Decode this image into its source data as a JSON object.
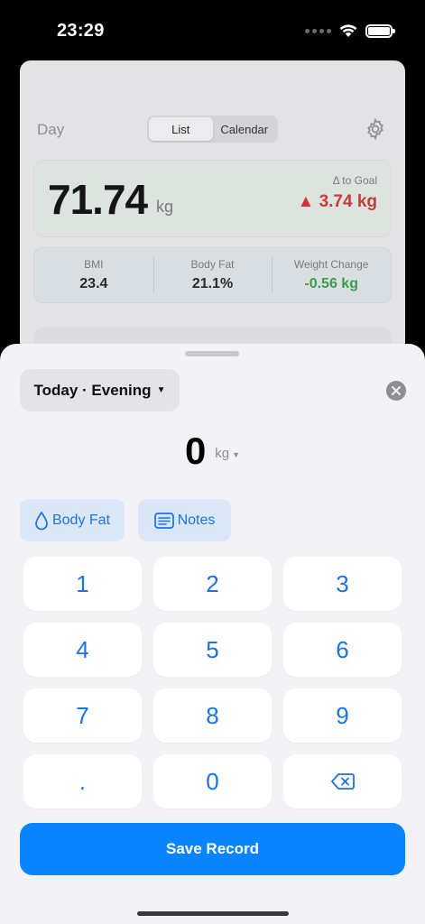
{
  "status_bar": {
    "time": "23:29",
    "icons": [
      "dots-icon",
      "wifi-icon",
      "battery-icon"
    ]
  },
  "background": {
    "day_label": "Day",
    "view_segments": [
      {
        "label": "List",
        "selected": true
      },
      {
        "label": "Calendar",
        "selected": false
      }
    ],
    "weight": {
      "value": "71.74",
      "unit": "kg"
    },
    "goal": {
      "label": "Δ to Goal",
      "value": "▲ 3.74 kg",
      "color": "#c83a3a"
    },
    "stats": [
      {
        "label": "BMI",
        "value": "23.4"
      },
      {
        "label": "Body Fat",
        "value": "21.1%"
      },
      {
        "label": "Weight Change",
        "value": "-0.56 kg",
        "color": "#3d9c4c"
      }
    ]
  },
  "sheet": {
    "date_selector": {
      "label": "Today · Evening"
    },
    "entry": {
      "value": "0",
      "unit": "kg"
    },
    "chips": {
      "body_fat": "Body Fat",
      "notes": "Notes"
    },
    "keys": [
      "1",
      "2",
      "3",
      "4",
      "5",
      "6",
      "7",
      "8",
      "9",
      ".",
      "0"
    ],
    "save_label": "Save Record"
  },
  "colors": {
    "accent": "#0a84ff",
    "key_text": "#1a73e8",
    "sheet_bg": "#f2f2f7"
  }
}
